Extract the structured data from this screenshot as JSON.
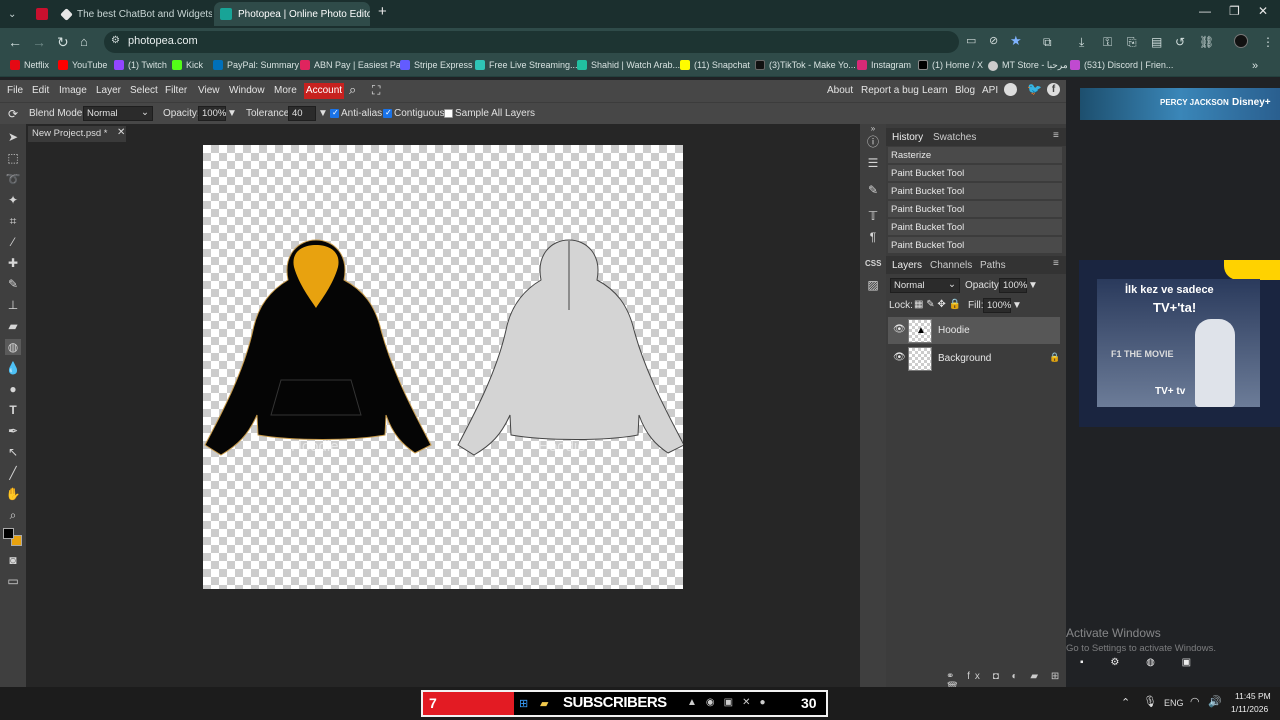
{
  "browser": {
    "tabs": [
      {
        "label": "",
        "icon": "webtoon-icon"
      },
      {
        "label": "The best ChatBot and Widgets",
        "icon": "chatbot-icon"
      },
      {
        "label": "Photopea | Online Photo Editor",
        "icon": "photopea-icon"
      }
    ],
    "url": "photopea.com",
    "bookmarks": [
      {
        "label": "Netflix",
        "color": "#e50914"
      },
      {
        "label": "YouTube",
        "color": "#ff0000"
      },
      {
        "label": "(1) Twitch",
        "color": "#9146ff"
      },
      {
        "label": "Kick",
        "color": "#53fc18"
      },
      {
        "label": "PayPal: Summary",
        "color": "#0070ba"
      },
      {
        "label": "ABN Pay | Easiest Pa...",
        "color": "#e0245e"
      },
      {
        "label": "Stripe Express",
        "color": "#635bff"
      },
      {
        "label": "Free Live Streaming...",
        "color": "#2ec4b6"
      },
      {
        "label": "Shahid | Watch Arab...",
        "color": "#21c0a0"
      },
      {
        "label": "(11) Snapchat",
        "color": "#fffc00"
      },
      {
        "label": "(3)TikTok - Make Yo...",
        "color": "#111111"
      },
      {
        "label": "Instagram",
        "color": "#d62976"
      },
      {
        "label": "(1) Home / X",
        "color": "#000000"
      },
      {
        "label": "MT Store - مرحبا",
        "color": "#cccccc"
      },
      {
        "label": "(531) Discord | Frien...",
        "color": "#c04ad0"
      }
    ]
  },
  "photopea": {
    "menu": [
      "File",
      "Edit",
      "Image",
      "Layer",
      "Select",
      "Filter",
      "View",
      "Window",
      "More"
    ],
    "account": "Account",
    "links": [
      "About",
      "Report a bug",
      "Learn",
      "Blog",
      "API"
    ],
    "options": {
      "blend_label": "Blend Mode:",
      "blend_value": "Normal",
      "opacity_label": "Opacity:",
      "opacity_value": "100%",
      "tolerance_label": "Tolerance:",
      "tolerance_value": "40",
      "antialias": "Anti-alias",
      "contiguous": "Contiguous",
      "sample": "Sample All Layers"
    },
    "doc_tab": "New Project.psd *",
    "canvas_text": [
      "Hoodie",
      "Hoodie"
    ],
    "panels": {
      "history_tab": "History",
      "swatches_tab": "Swatches",
      "history": [
        "Rasterize",
        "Paint Bucket Tool",
        "Paint Bucket Tool",
        "Paint Bucket Tool",
        "Paint Bucket Tool",
        "Paint Bucket Tool"
      ],
      "layers_tab": "Layers",
      "channels_tab": "Channels",
      "paths_tab": "Paths",
      "layer_blend": "Normal",
      "opacity_label": "Opacity:",
      "opacity_value": "100%",
      "lock_label": "Lock:",
      "fill_label": "Fill:",
      "fill_value": "100%",
      "layers": [
        "Hoodie",
        "Background"
      ]
    }
  },
  "ads": {
    "top_brand": "Disney+",
    "top_title": "PERCY JACKSON",
    "main_line1": "İlk kez ve sadece",
    "main_line2": "TV+'ta!",
    "main_title": "F1 THE MOVIE",
    "main_footer": "TV+ tv"
  },
  "watermark": {
    "line1": "Activate Windows",
    "line2": "Go to Settings to activate Windows."
  },
  "taskbar": {
    "left_num": "7",
    "subs": "SUBSCRIBERS",
    "right_num": "30",
    "lang": "ENG",
    "time": "11:45 PM",
    "date": "1/11/2026"
  }
}
